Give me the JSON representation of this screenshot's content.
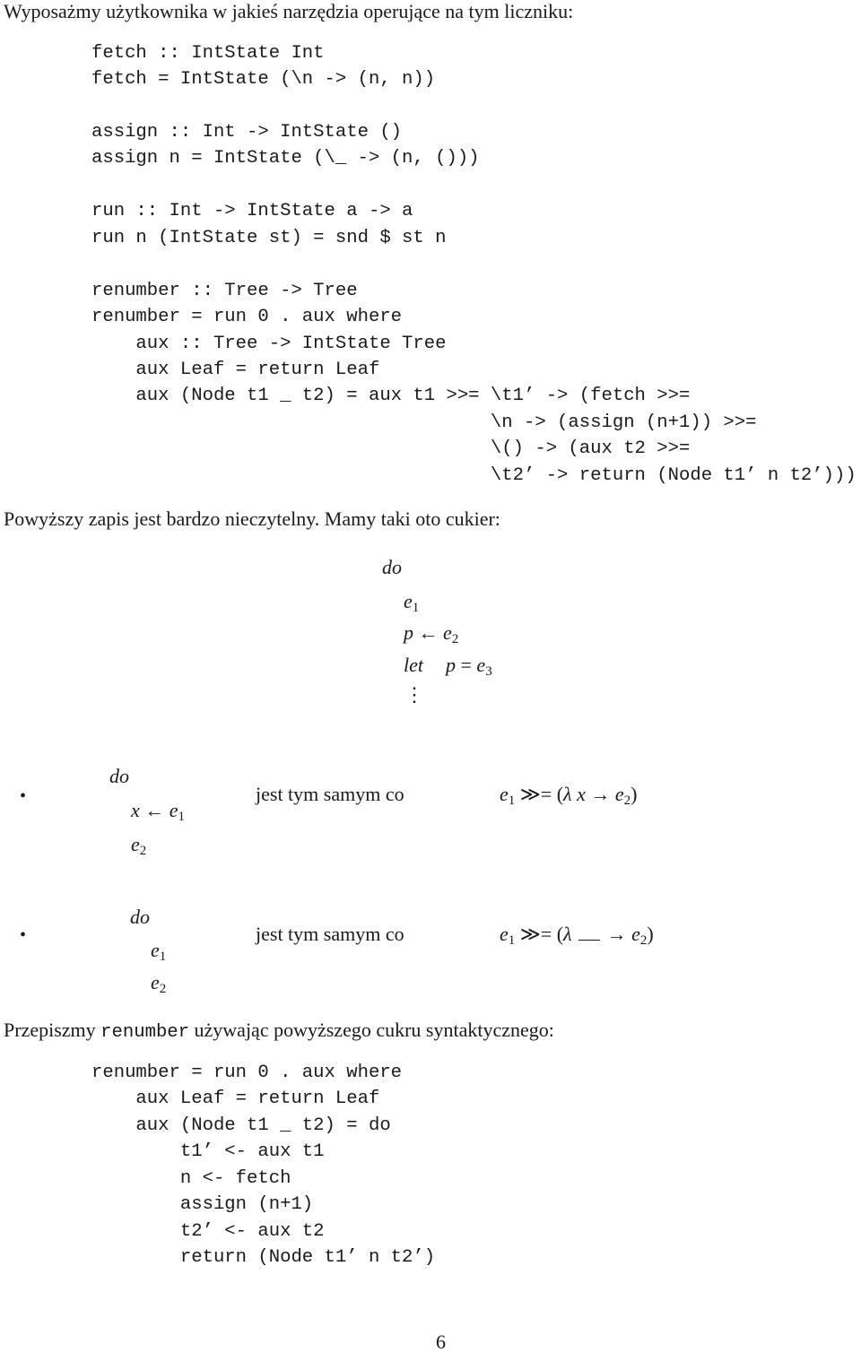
{
  "intro": "Wyposażmy użytkownika w jakieś narzędzia operujące na tym liczniku:",
  "code_block_1": [
    "fetch :: IntState Int",
    "fetch = IntState (\\n -> (n, n))",
    "",
    "assign :: Int -> IntState ()",
    "assign n = IntState (\\_ -> (n, ()))",
    "",
    "run :: Int -> IntState a -> a",
    "run n (IntState st) = snd $ st n",
    "",
    "renumber :: Tree -> Tree",
    "renumber = run 0 . aux where",
    "    aux :: Tree -> IntState Tree",
    "    aux Leaf = return Leaf",
    "    aux (Node t1 _ t2) = aux t1 >>= \\t1’ -> (fetch >>=",
    "                                    \\n -> (assign (n+1)) >>=",
    "                                    \\() -> (aux t2 >>=",
    "                                    \\t2’ -> return (Node t1’ n t2’)))"
  ],
  "paragraph_2": "Powyższy zapis jest bardzo nieczytelny. Mamy taki oto cukier:",
  "do_block": {
    "keyword": "do",
    "e1": "e",
    "e1_sub": "1",
    "p": "p",
    "arrow": "←",
    "e2": "e",
    "e2_sub": "2",
    "let_kw": "let",
    "let_p": "p",
    "eq": "=",
    "e3": "e",
    "e3_sub": "3",
    "dots": "⋮"
  },
  "rules": [
    {
      "bullet": "•",
      "do_kw": "do",
      "lines": [
        {
          "var": "x",
          "arrow": "←",
          "e": "e",
          "sub": "1"
        },
        {
          "var": "",
          "arrow": "",
          "e": "e",
          "sub": "2"
        }
      ],
      "middle_text": "jest tym samym co",
      "rhs": {
        "e1": "e",
        "e1_sub": "1",
        "bind": "≫=",
        "open": "(",
        "lambda": "λ",
        "param": "x",
        "to": "→",
        "e2": "e",
        "e2_sub": "2",
        "close": ")"
      }
    },
    {
      "bullet": "•",
      "do_kw": "do",
      "lines": [
        {
          "var": "",
          "arrow": "",
          "e": "e",
          "sub": "1"
        },
        {
          "var": "",
          "arrow": "",
          "e": "e",
          "sub": "2"
        }
      ],
      "middle_text": "jest tym samym co",
      "rhs": {
        "e1": "e",
        "e1_sub": "1",
        "bind": "≫=",
        "open": "(",
        "lambda": "λ",
        "param": "__",
        "to": "→",
        "e2": "e",
        "e2_sub": "2",
        "close": ")"
      }
    }
  ],
  "paragraph_3": {
    "before": "Przepiszmy ",
    "code": "renumber",
    "after": " używając powyższego cukru syntaktycznego:"
  },
  "code_block_2": [
    "renumber = run 0 . aux where",
    "    aux Leaf = return Leaf",
    "    aux (Node t1 _ t2) = do",
    "        t1’ <- aux t1",
    "        n <- fetch",
    "        assign (n+1)",
    "        t2’ <- aux t2",
    "        return (Node t1’ n t2’)"
  ],
  "page_number": "6"
}
